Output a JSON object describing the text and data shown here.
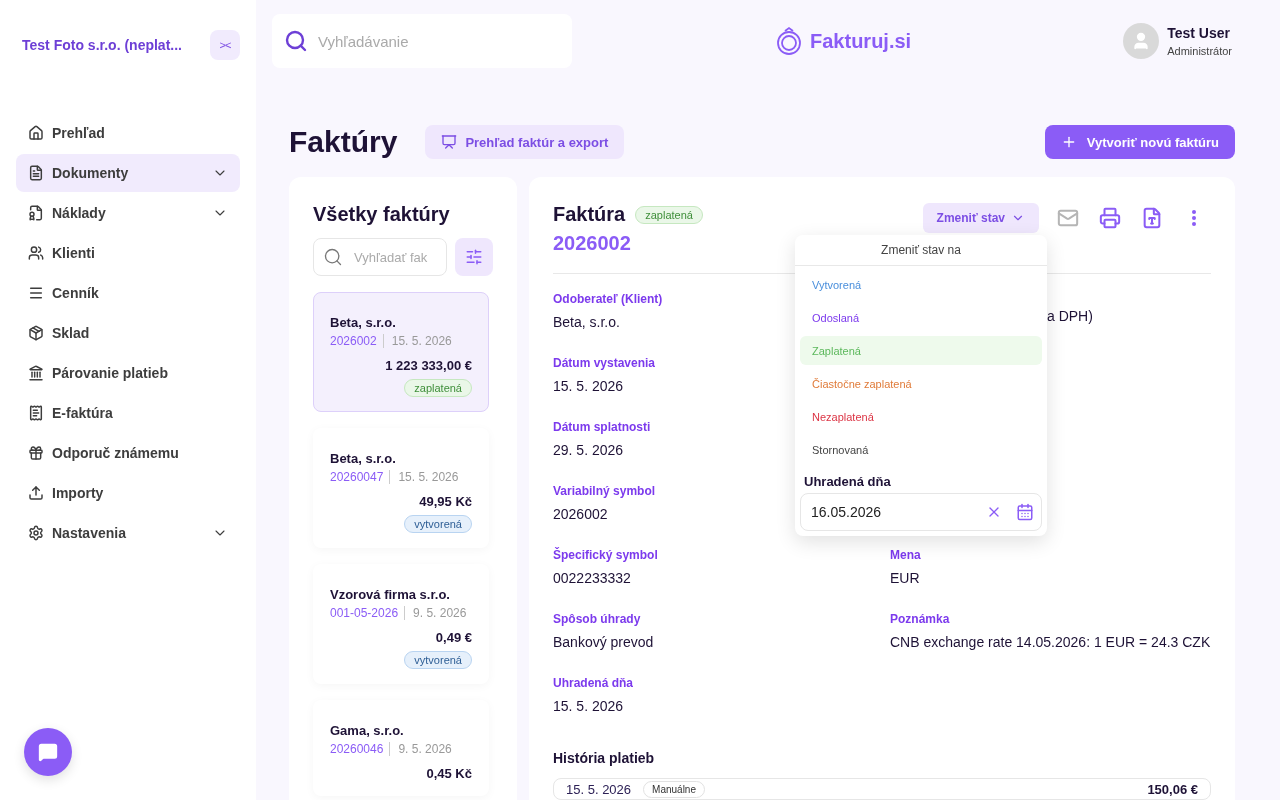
{
  "sidebar": {
    "company": "Test Foto s.r.o. (neplat...",
    "collapse_label": "><",
    "items": [
      {
        "label": "Prehľad",
        "selected": false,
        "expandable": false
      },
      {
        "label": "Dokumenty",
        "selected": true,
        "expandable": true
      },
      {
        "label": "Náklady",
        "selected": false,
        "expandable": true
      },
      {
        "label": "Klienti",
        "selected": false,
        "expandable": false
      },
      {
        "label": "Cenník",
        "selected": false,
        "expandable": false
      },
      {
        "label": "Sklad",
        "selected": false,
        "expandable": false
      },
      {
        "label": "Párovanie platieb",
        "selected": false,
        "expandable": false
      },
      {
        "label": "E-faktúra",
        "selected": false,
        "expandable": false
      },
      {
        "label": "Odporuč známemu",
        "selected": false,
        "expandable": false
      },
      {
        "label": "Importy",
        "selected": false,
        "expandable": false
      },
      {
        "label": "Nastavenia",
        "selected": false,
        "expandable": true
      }
    ]
  },
  "topbar": {
    "search": {
      "placeholder": "Vyhľadávanie"
    },
    "logo": "Fakturuj.si",
    "user": {
      "name": "Test User",
      "role": "Administrátor"
    }
  },
  "page": {
    "title": "Faktúry",
    "overview_button": "Prehľad faktúr a export",
    "create_button": "Vytvoriť novú faktúru"
  },
  "list": {
    "title": "Všetky faktúry",
    "search": {
      "placeholder": "Vyhľadať fak"
    },
    "invoices": [
      {
        "client": "Beta, s.r.o.",
        "number": "2026002",
        "date": "15. 5. 2026",
        "amount": "1 223 333,00 €",
        "status": {
          "kind": "paid",
          "label": "zaplatená"
        },
        "selected": true
      },
      {
        "client": "Beta, s.r.o.",
        "number": "20260047",
        "date": "15. 5. 2026",
        "amount": "49,95 Kč",
        "status": {
          "kind": "created",
          "label": "vytvorená"
        },
        "selected": false
      },
      {
        "client": "Vzorová firma s.r.o.",
        "number": "001-05-2026",
        "date": "9. 5. 2026",
        "amount": "0,49 €",
        "status": {
          "kind": "created",
          "label": "vytvorená"
        },
        "selected": false
      },
      {
        "client": "Gama, s.r.o.",
        "number": "20260046",
        "date": "9. 5. 2026",
        "amount": "0,45 Kč",
        "selected": false
      }
    ]
  },
  "detail": {
    "title": "Faktúra",
    "status": {
      "kind": "paid",
      "label": "zaplatená"
    },
    "number": "2026002",
    "change_status_button": "Zmeniť stav",
    "actions": [
      {
        "kind": "email",
        "disabled": true
      },
      {
        "kind": "print",
        "disabled": false
      },
      {
        "kind": "pdf",
        "disabled": false
      },
      {
        "kind": "more",
        "disabled": false
      }
    ],
    "rows": [
      {
        "left": {
          "label": "Odoberateľ (Klient)",
          "value": "Beta, s.r.o."
        },
        "right": {
          "value": "a DPH)"
        }
      },
      {
        "left": {
          "label": "Dátum vystavenia",
          "value": "15. 5. 2026"
        }
      },
      {
        "left": {
          "label": "Dátum splatnosti",
          "value": "29. 5. 2026"
        }
      },
      {
        "left": {
          "label": "Variabilný symbol",
          "value": "2026002"
        }
      },
      {
        "left": {
          "label": "Špecifický symbol",
          "value": "0022233332"
        },
        "right": {
          "label": "Mena",
          "value": "EUR"
        }
      },
      {
        "left": {
          "label": "Spôsob úhrady",
          "value": "Bankový prevod"
        },
        "right": {
          "label": "Poznámka",
          "value": "CNB exchange rate 14.05.2026: 1 EUR = 24.3 CZK"
        }
      },
      {
        "left": {
          "label": "Uhradená dňa",
          "value": "15. 5. 2026"
        }
      }
    ],
    "history": {
      "title": "História platieb",
      "payments": [
        {
          "date": "15. 5. 2026",
          "method": "Manuálne",
          "amount": "150,06 €"
        }
      ]
    },
    "status_menu": {
      "title": "Zmeniť stav na",
      "options": [
        {
          "label": "Vytvorená",
          "color": "#4a8fdc",
          "selected": false
        },
        {
          "label": "Odoslaná",
          "color": "#7c3aed",
          "selected": false
        },
        {
          "label": "Zaplatená",
          "color": "#5cb85c",
          "selected": true
        },
        {
          "label": "Čiastočne zaplatená",
          "color": "#e07b39",
          "selected": false
        },
        {
          "label": "Nezaplatená",
          "color": "#dc3545",
          "selected": false
        },
        {
          "label": "Stornovaná",
          "color": "#444444",
          "selected": false
        }
      ],
      "paid_date_label": "Uhradená dňa",
      "paid_date": "16.05.2026"
    }
  }
}
